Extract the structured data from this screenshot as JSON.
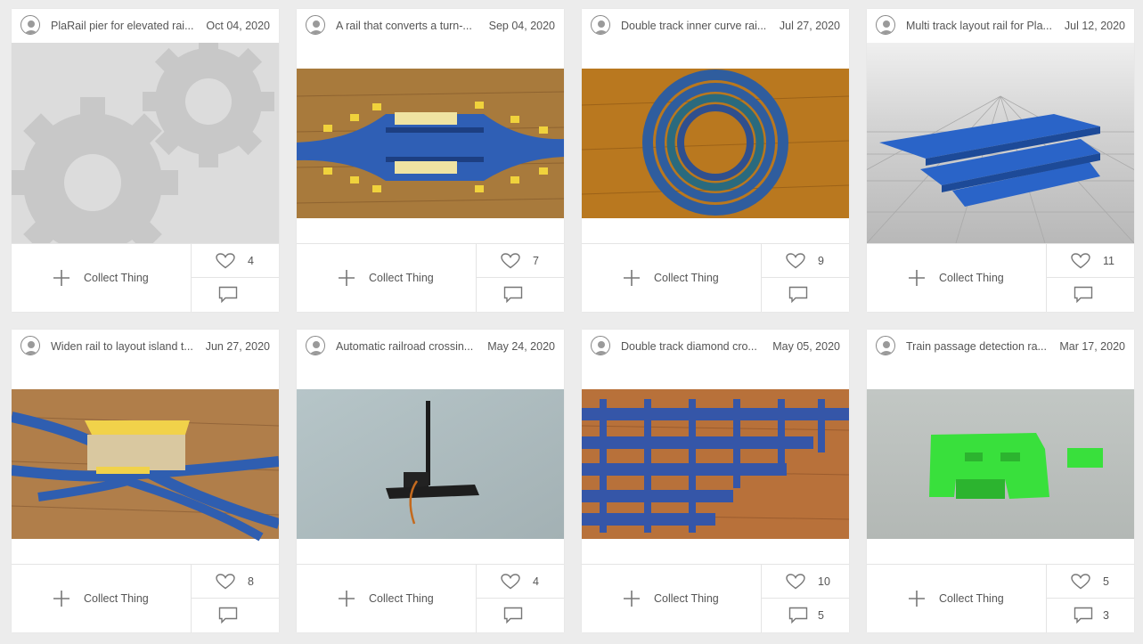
{
  "colors": {
    "background": "#ececec",
    "card": "#ffffff",
    "text": "#555555",
    "divider": "#e4e4e4",
    "icon": "#777777"
  },
  "cards": [
    {
      "title": "PlaRail pier for elevated rai...",
      "date": "Oct 04, 2020",
      "collect_label": "Collect Thing",
      "likes": "4",
      "comments": "",
      "thumbnail": "gears-placeholder"
    },
    {
      "title": "A rail that converts a turn-...",
      "date": "Sep 04, 2020",
      "collect_label": "Collect Thing",
      "likes": "7",
      "comments": "",
      "thumbnail": "photo-blue-track-yellow-supports"
    },
    {
      "title": "Double track inner curve rai...",
      "date": "Jul 27, 2020",
      "collect_label": "Collect Thing",
      "likes": "9",
      "comments": "",
      "thumbnail": "photo-circular-double-track"
    },
    {
      "title": "Multi track layout rail for Pla...",
      "date": "Jul 12, 2020",
      "collect_label": "Collect Thing",
      "likes": "11",
      "comments": "",
      "thumbnail": "render-blue-multi-track"
    },
    {
      "title": "Widen rail to layout island t...",
      "date": "Jun 27, 2020",
      "collect_label": "Collect Thing",
      "likes": "8",
      "comments": "",
      "thumbnail": "photo-island-platform"
    },
    {
      "title": "Automatic railroad crossin...",
      "date": "May 24, 2020",
      "collect_label": "Collect Thing",
      "likes": "4",
      "comments": "",
      "thumbnail": "photo-crossing-servo"
    },
    {
      "title": "Double track diamond cro...",
      "date": "May 05, 2020",
      "collect_label": "Collect Thing",
      "likes": "10",
      "comments": "5",
      "thumbnail": "photo-diamond-crossings"
    },
    {
      "title": "Train passage detection ra...",
      "date": "Mar 17, 2020",
      "collect_label": "Collect Thing",
      "likes": "5",
      "comments": "3",
      "thumbnail": "photo-green-print"
    }
  ]
}
